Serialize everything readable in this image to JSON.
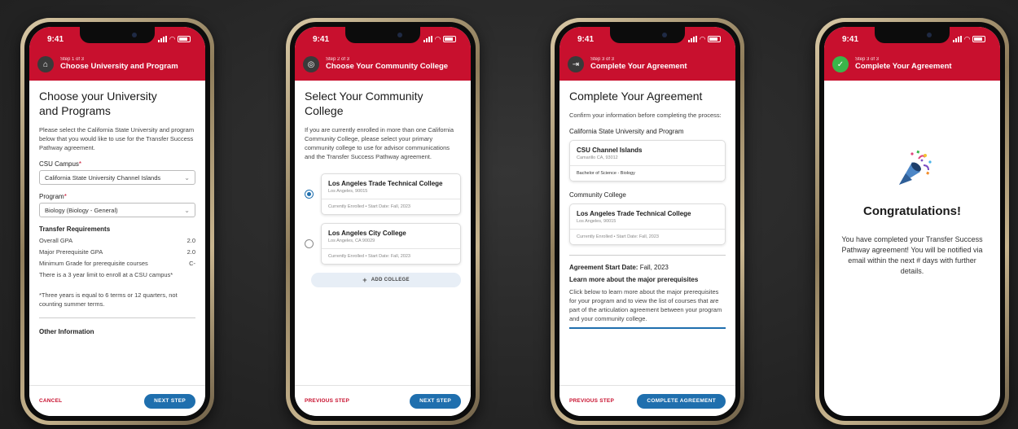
{
  "status_time": "9:41",
  "screen1": {
    "step": "Step 1 of 3",
    "header_title": "Choose University and Program",
    "title_line1": "Choose your University",
    "title_line2": "and Programs",
    "intro": "Please select the California State University and program below that you would like to use for the Transfer Success Pathway agreement.",
    "campus_label": "CSU Campus",
    "campus_value": "California State University Channel Islands",
    "program_label": "Program",
    "program_value": "Biology (Biology - General)",
    "req_title": "Transfer Requirements",
    "requirements": [
      {
        "label": "Overall GPA",
        "value": "2.0"
      },
      {
        "label": "Major Prerequisite GPA",
        "value": "2.0"
      },
      {
        "label": "Minimum Grade for prerequisite courses",
        "value": "C-"
      }
    ],
    "limit_note": "There is a 3 year limit to enroll at a CSU campus*",
    "footnote": "*Three years is equal to 6 terms or 12 quarters, not counting summer terms.",
    "other_info": "Other Information",
    "cancel": "CANCEL",
    "next": "NEXT STEP"
  },
  "screen2": {
    "step": "Step 2 of 3",
    "header_title": "Choose Your Community College",
    "title": "Select Your Community College",
    "intro": "If you are currently enrolled in more than one California Community College, please select your primary community college to use for advisor communications and the Transfer Success Pathway agreement.",
    "colleges": [
      {
        "name": "Los Angeles Trade Technical College",
        "location": "Los Angeles, 90015",
        "status": "Currently Enrolled • Start Date: Fall, 2023"
      },
      {
        "name": "Los Angeles City College",
        "location": "Los Angeles, CA 90029",
        "status": "Currently Enrolled • Start Date: Fall, 2023"
      }
    ],
    "add_college": "ADD COLLEGE",
    "previous": "PREVIOUS STEP",
    "next": "NEXT STEP"
  },
  "screen3": {
    "step": "Step 3 of 3",
    "header_title": "Complete Your Agreement",
    "title": "Complete Your Agreement",
    "intro": "Confirm your information before completing the process:",
    "csu_section": "California State University and Program",
    "csu_name": "CSU Channel Islands",
    "csu_location": "Camarillo CA, 93012",
    "csu_degree": "Bachelor of Science - Biology",
    "cc_section": "Community College",
    "cc_name": "Los Angeles Trade Technical College",
    "cc_location": "Los Angeles, 90015",
    "cc_status": "Currently Enrolled • Start Date: Fall, 2023",
    "start_label": "Agreement Start Date:",
    "start_value": "Fall, 2023",
    "learn_title": "Learn more about the major prerequisites",
    "learn_text": "Click below to learn more about the major prerequisites for your program and to view the list of courses that are part of the articulation agreement between your program and your community college.",
    "previous": "PREVIOUS STEP",
    "complete": "COMPLETE AGREEMENT"
  },
  "screen4": {
    "step": "Step 3 of 3",
    "header_title": "Complete Your Agreement",
    "title": "Congratulations!",
    "message": "You have completed your Transfer Success Pathway agreement! You will be notified via email within the next # days with further details."
  },
  "colors": {
    "brand_red": "#c8102e",
    "primary_blue": "#1f6fae",
    "success_green": "#3bb54a"
  },
  "icons": {
    "screen1_header": "university-icon",
    "screen2_header": "college-icon",
    "screen3_header": "agreement-icon",
    "screen4_header": "check-icon",
    "congrats": "party-popper-icon"
  }
}
